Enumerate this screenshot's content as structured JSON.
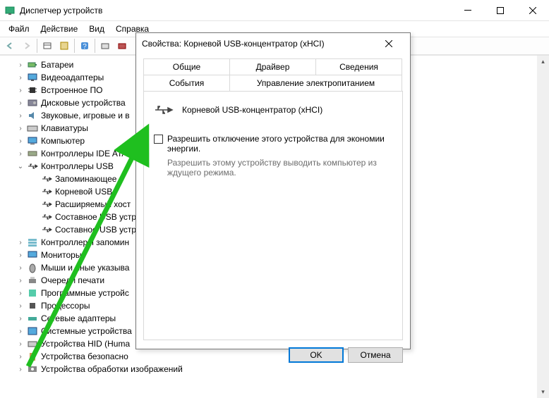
{
  "window": {
    "title": "Диспетчер устройств"
  },
  "menu": {
    "file": "Файл",
    "action": "Действие",
    "view": "Вид",
    "help": "Справка"
  },
  "tree": {
    "items": [
      {
        "label": "Батареи"
      },
      {
        "label": "Видеоадаптеры"
      },
      {
        "label": "Встроенное ПО"
      },
      {
        "label": "Дисковые устройства"
      },
      {
        "label": "Звуковые, игровые и в"
      },
      {
        "label": "Клавиатуры"
      },
      {
        "label": "Компьютер"
      },
      {
        "label": "Контроллеры IDE ATA/"
      },
      {
        "label": "Контроллеры USB"
      },
      {
        "label": "Контроллеры запомин"
      },
      {
        "label": "Мониторы"
      },
      {
        "label": "Мыши и иные указыва"
      },
      {
        "label": "Очереди печати"
      },
      {
        "label": "Программные устройс"
      },
      {
        "label": "Процессоры"
      },
      {
        "label": "Сетевые адаптеры"
      },
      {
        "label": "Системные устройства"
      },
      {
        "label": "Устройства HID (Huma"
      },
      {
        "label": "Устройства безопасно"
      },
      {
        "label": "Устройства обработки изображений"
      }
    ],
    "usb_children": [
      {
        "label": "Запоминающее"
      },
      {
        "label": "Корневой USB-"
      },
      {
        "label": "Расширяемый хост"
      },
      {
        "label": "Составное USB устр"
      },
      {
        "label": "Составное USB устр"
      }
    ]
  },
  "dialog": {
    "title": "Свойства: Корневой USB-концентратор (xHCI)",
    "tabs": {
      "general": "Общие",
      "driver": "Драйвер",
      "details": "Сведения",
      "events": "События",
      "power": "Управление электропитанием"
    },
    "device_name": "Корневой USB-концентратор (xHCI)",
    "checkbox1": "Разрешить отключение этого устройства для экономии энергии.",
    "checkbox2": "Разрешить этому устройству выводить компьютер из ждущего режима.",
    "ok": "OK",
    "cancel": "Отмена"
  }
}
